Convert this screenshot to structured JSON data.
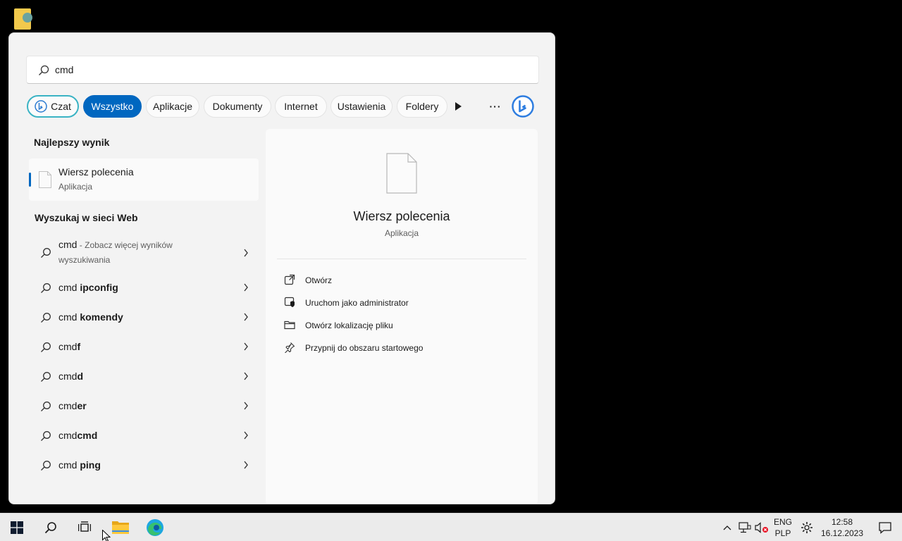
{
  "search": {
    "value": "cmd"
  },
  "filters": {
    "chat": "Czat",
    "all": "Wszystko",
    "apps": "Aplikacje",
    "documents": "Dokumenty",
    "internet": "Internet",
    "settings": "Ustawienia",
    "folders": "Foldery",
    "more": "···"
  },
  "best_match": {
    "title": "Najlepszy wynik",
    "name": "Wiersz polecenia",
    "type": "Aplikacja"
  },
  "web": {
    "title": "Wyszukaj w sieci Web",
    "first": {
      "term": "cmd",
      "suffix": " - Zobacz więcej wyników wyszukiwania"
    },
    "items": [
      {
        "prefix": "cmd ",
        "bold": "ipconfig"
      },
      {
        "prefix": "cmd ",
        "bold": "komendy"
      },
      {
        "prefix": "cmd",
        "bold": "f"
      },
      {
        "prefix": "cmd",
        "bold": "d"
      },
      {
        "prefix": "cmd",
        "bold": "er"
      },
      {
        "prefix": "cmd",
        "bold": "cmd"
      },
      {
        "prefix": "cmd ",
        "bold": "ping"
      }
    ]
  },
  "detail": {
    "name": "Wiersz polecenia",
    "type": "Aplikacja",
    "actions": [
      "Otwórz",
      "Uruchom jako administrator",
      "Otwórz lokalizację pliku",
      "Przypnij do obszaru startowego"
    ]
  },
  "taskbar": {
    "lang_top": "ENG",
    "lang_bottom": "PLP",
    "time": "12:58",
    "date": "16.12.2023"
  },
  "colors": {
    "accent": "#0067c0",
    "chat_border": "#3ab3c4"
  }
}
